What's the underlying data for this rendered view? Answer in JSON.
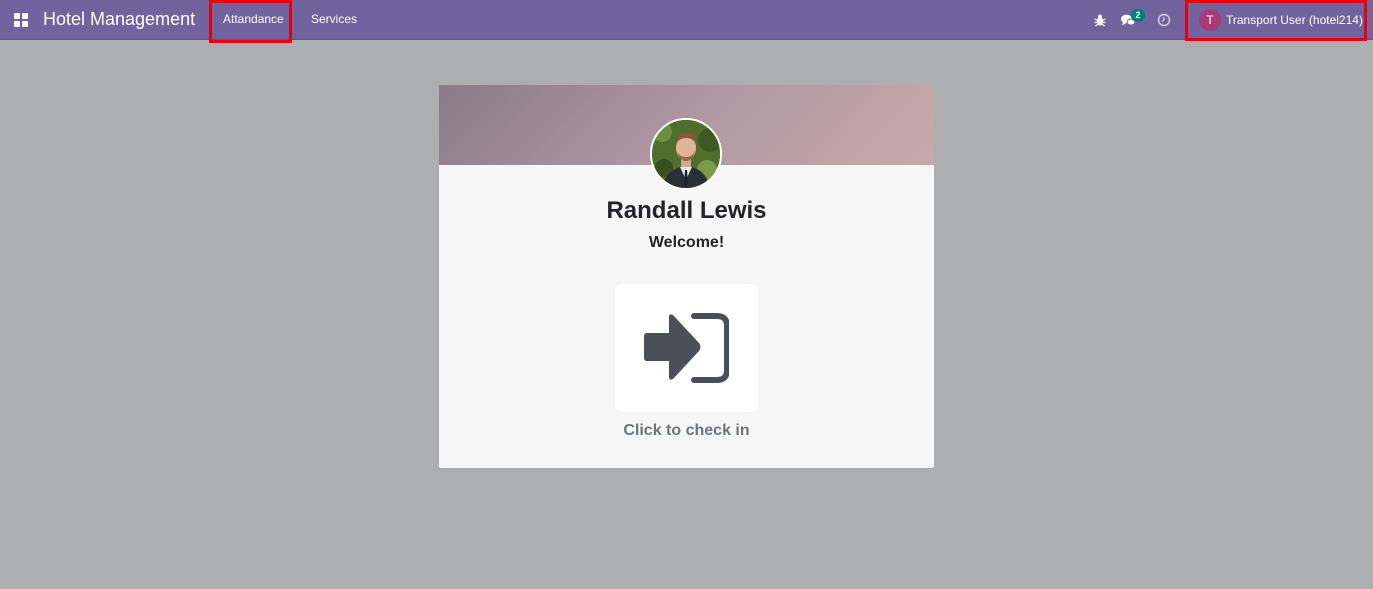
{
  "navbar": {
    "brand": "Hotel Management",
    "menu": [
      {
        "label": "Attandance"
      },
      {
        "label": "Services"
      }
    ],
    "chat_badge_count": "2",
    "user": {
      "initial": "T",
      "name": "Transport User (hotel214)"
    },
    "icons": [
      "apps-icon",
      "bug-icon",
      "chat-icon",
      "clock-icon"
    ]
  },
  "card": {
    "employee_name": "Randall Lewis",
    "welcome_text": "Welcome!",
    "checkin_label": "Click to check in",
    "checkin_icon": "sign-in-icon"
  },
  "colors": {
    "navbar": "#71639e",
    "background": "#adaeb0",
    "highlight": "#e8000d",
    "badge": "#017e84",
    "avatar": "#a63b75"
  }
}
